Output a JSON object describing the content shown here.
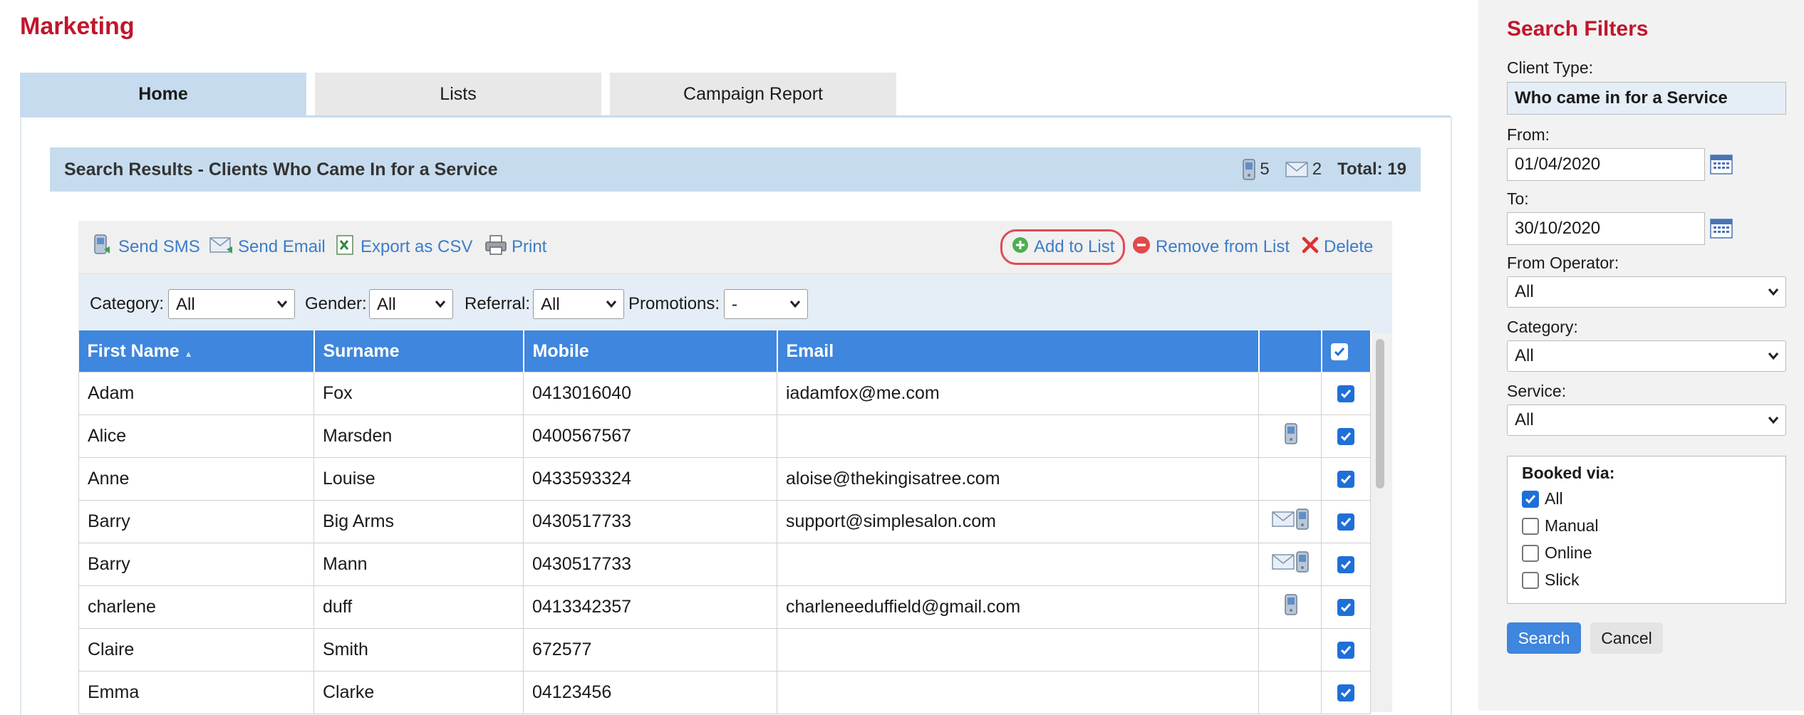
{
  "page": {
    "title": "Marketing"
  },
  "tabs": [
    {
      "label": "Home",
      "active": true
    },
    {
      "label": "Lists",
      "active": false
    },
    {
      "label": "Campaign Report",
      "active": false
    }
  ],
  "results": {
    "title": "Search Results - Clients Who Came In for a Service",
    "sms_count": "5",
    "email_count": "2",
    "total": "Total: 19"
  },
  "toolbar": {
    "send_sms": "Send SMS",
    "send_email": "Send Email",
    "export_csv": "Export as CSV",
    "print": "Print",
    "add_to_list": "Add to List",
    "remove_from_list": "Remove from List",
    "delete": "Delete"
  },
  "filters": {
    "category_label": "Category:",
    "category_value": "All",
    "gender_label": "Gender:",
    "gender_value": "All",
    "referral_label": "Referral:",
    "referral_value": "All",
    "promotions_label": "Promotions:",
    "promotions_value": "-"
  },
  "table": {
    "columns": [
      "First Name",
      "Surname",
      "Mobile",
      "Email"
    ],
    "sort_indicator": "▲",
    "rows": [
      {
        "first": "Adam",
        "surname": "Fox",
        "mobile": "0413016040",
        "email": "iadamfox@me.com",
        "icons": [],
        "checked": true
      },
      {
        "first": "Alice",
        "surname": "Marsden",
        "mobile": "0400567567",
        "email": "",
        "icons": [
          "phone"
        ],
        "checked": true
      },
      {
        "first": "Anne",
        "surname": "Louise",
        "mobile": "0433593324",
        "email": "aloise@thekingisatree.com",
        "icons": [],
        "checked": true
      },
      {
        "first": "Barry",
        "surname": "Big Arms",
        "mobile": "0430517733",
        "email": "support@simplesalon.com",
        "icons": [
          "mail",
          "phone"
        ],
        "checked": true
      },
      {
        "first": "Barry",
        "surname": "Mann",
        "mobile": "0430517733",
        "email": "",
        "icons": [
          "mail",
          "phone"
        ],
        "checked": true
      },
      {
        "first": "charlene",
        "surname": "duff",
        "mobile": "0413342357",
        "email": "charleneeduffield@gmail.com",
        "icons": [
          "phone"
        ],
        "checked": true
      },
      {
        "first": "Claire",
        "surname": "Smith",
        "mobile": "672577",
        "email": "",
        "icons": [],
        "checked": true
      },
      {
        "first": "Emma",
        "surname": "Clarke",
        "mobile": "04123456",
        "email": "",
        "icons": [],
        "checked": true
      }
    ]
  },
  "sidebar": {
    "title": "Search Filters",
    "client_type_label": "Client Type:",
    "client_type_value": "Who came in for a Service",
    "from_label": "From:",
    "from_value": "01/04/2020",
    "to_label": "To:",
    "to_value": "30/10/2020",
    "operator_label": "From Operator:",
    "operator_value": "All",
    "category_label": "Category:",
    "category_value": "All",
    "service_label": "Service:",
    "service_value": "All",
    "booked_via_label": "Booked via:",
    "booked_via": [
      {
        "label": "All",
        "checked": true
      },
      {
        "label": "Manual",
        "checked": false
      },
      {
        "label": "Online",
        "checked": false
      },
      {
        "label": "Slick",
        "checked": false
      }
    ],
    "search_button": "Search",
    "cancel_button": "Cancel"
  },
  "colors": {
    "brand_red": "#c0162c",
    "header_blue": "#3e86de",
    "accent_link": "#3d7cc9",
    "light_blue": "#c6dcee"
  }
}
